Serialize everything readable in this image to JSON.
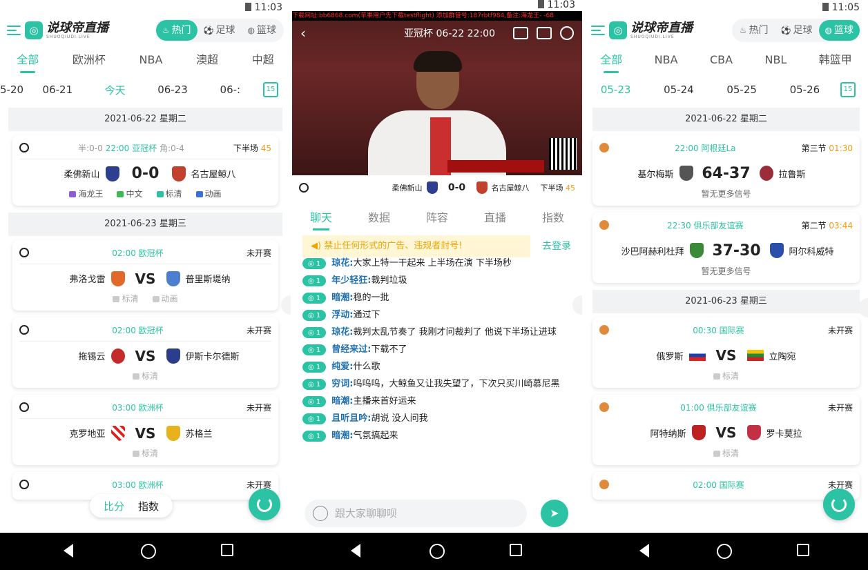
{
  "status": {
    "time1": "11:03",
    "time2": "11:03",
    "time3": "11:05"
  },
  "app": {
    "logo": "说球帝直播",
    "logo_sub": "SHUOQIUDI.LIVE"
  },
  "sports": [
    "热门",
    "足球",
    "篮球"
  ],
  "panel1": {
    "tabs": [
      "全部",
      "欧洲杯",
      "NBA",
      "澳超",
      "中超"
    ],
    "dates": [
      "5-20",
      "06-21",
      "今天",
      "06-23",
      "06-:"
    ],
    "cal": "15",
    "day1": "2021-06-22 星期二",
    "m1": {
      "half": "半:0-0",
      "time": "22:00 亚冠杯",
      "corner": "角:0-4",
      "state": "下半场",
      "minute": "45",
      "home": "柔佛新山",
      "score": "0-0",
      "away": "名古屋鲸八",
      "tags": [
        "海龙王",
        "中文",
        "标清",
        "动画"
      ]
    },
    "day2": "2021-06-23 星期三",
    "m2": {
      "time": "02:00 欧冠杯",
      "state": "未开赛",
      "home": "弗洛戈雷",
      "vs": "VS",
      "away": "普里斯堤纳",
      "tags": [
        "标清",
        "动画"
      ]
    },
    "m3": {
      "time": "02:00 欧冠杯",
      "state": "未开赛",
      "home": "拖锡云",
      "vs": "VS",
      "away": "伊斯卡尔德斯",
      "tags": [
        "标清"
      ]
    },
    "m4": {
      "time": "03:00 欧洲杯",
      "state": "未开赛",
      "home": "克罗地亚",
      "vs": "VS",
      "away": "苏格兰",
      "tags": [
        "标清"
      ]
    },
    "m5": {
      "time": "03:00 欧洲杯",
      "state": "未开赛"
    },
    "bottom": [
      "比分",
      "指数"
    ]
  },
  "panel2": {
    "ticker": "下载网址:bb6868.com(苹果用户先下载testflight) 添加群管号:187rbtf984,备注:海龙王- -68",
    "title": "亚冠杯 06-22 22:00",
    "match": {
      "home": "柔佛新山",
      "score": "0-0",
      "away": "名古屋鲸八",
      "state": "下半场",
      "minute": "45"
    },
    "tabs": [
      "聊天",
      "数据",
      "阵容",
      "直播",
      "指数"
    ],
    "notice": "禁止任何形式的广告、违规者封号!",
    "login": "去登录",
    "messages": [
      {
        "lv": "1",
        "user": "琼花:",
        "text": "大家上特一干起来  上半场在演  下半场秒"
      },
      {
        "lv": "1",
        "user": "年少轻狂:",
        "text": "裁判垃圾"
      },
      {
        "lv": "1",
        "user": "暗潮:",
        "text": "稳的一批"
      },
      {
        "lv": "1",
        "user": "浮动:",
        "text": "通过下"
      },
      {
        "lv": "1",
        "user": "琼花:",
        "text": "裁判太乱节奏了 我刚才问裁判了 他说下半场让进球"
      },
      {
        "lv": "1",
        "user": "曾经来过:",
        "text": "下载不了"
      },
      {
        "lv": "1",
        "user": "纯爱:",
        "text": "什么歌"
      },
      {
        "lv": "1",
        "user": "穷词:",
        "text": "呜呜呜，大鲸鱼又让我失望了，下次只买川崎慕尼黑"
      },
      {
        "lv": "1",
        "user": "暗潮:",
        "text": "主播来首好运来"
      },
      {
        "lv": "1",
        "user": "且听且吟:",
        "text": "胡说 没人问我"
      },
      {
        "lv": "1",
        "user": "暗潮:",
        "text": "气氛搞起来"
      }
    ],
    "input_placeholder": "跟大家聊聊呗"
  },
  "panel3": {
    "tabs": [
      "全部",
      "NBA",
      "CBA",
      "NBL",
      "韩篮甲"
    ],
    "dates": [
      "05-23",
      "05-24",
      "05-25",
      "05-26"
    ],
    "cal": "15",
    "day1": "2021-06-22 星期二",
    "m1": {
      "time": "22:00 阿根廷La",
      "state": "第三节",
      "clock": "01:30",
      "home": "基尔梅斯",
      "score": "64-37",
      "away": "拉鲁斯",
      "note": "暂无更多信号"
    },
    "m2": {
      "time": "22:30 俱乐部友谊赛",
      "state": "第二节",
      "clock": "03:44",
      "home": "沙巴阿赫利杜拜",
      "score": "37-30",
      "away": "阿尔科威特",
      "note": "暂无更多信号"
    },
    "day2": "2021-06-23 星期三",
    "m3": {
      "time": "00:30 国际赛",
      "state": "未开赛",
      "home": "俄罗斯",
      "vs": "VS",
      "away": "立陶宛",
      "tag": "标清"
    },
    "m4": {
      "time": "01:00 俱乐部友谊赛",
      "state": "未开赛",
      "home": "阿特纳斯",
      "vs": "VS",
      "away": "罗卡莫拉",
      "tag": "标清"
    },
    "m5": {
      "time": "02:00 国际赛",
      "state": "未开赛"
    }
  },
  "colors": {
    "accent": "#2cc3a5",
    "live_minute": "#f39c12",
    "username": "#1f6fae"
  },
  "icons": [
    "menu-icon",
    "logo-icon",
    "calendar-icon",
    "soccer-ball-icon",
    "basketball-icon",
    "refresh-icon",
    "back-icon",
    "home-icon",
    "recents-icon",
    "send-icon",
    "smile-icon"
  ]
}
